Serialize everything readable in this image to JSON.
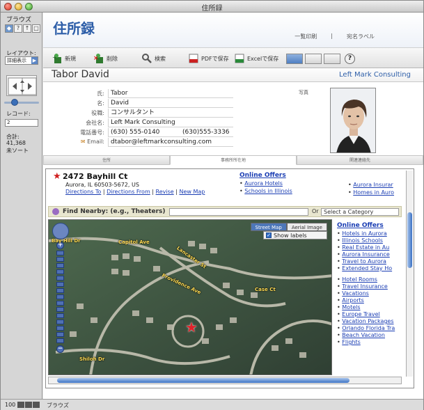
{
  "window": {
    "title": "住所録"
  },
  "sidebar": {
    "mode_label": "ブラウズ",
    "layout_label": "レイアウト:",
    "layout_value": "詳細表示",
    "record_label": "レコード:",
    "record_value": "2",
    "total_label": "合計:",
    "total_value": "41,368",
    "sort_status": "未ソート"
  },
  "bottombar": {
    "zoom": "100",
    "mode": "ブラウズ"
  },
  "app": {
    "title": "住所録",
    "links": [
      "一覧印刷",
      "宛名ラベル"
    ]
  },
  "toolbar": {
    "new_label": "新規",
    "delete_label": "削除",
    "search_label": "検索",
    "pdf_label": "PDFで保存",
    "excel_label": "Excelで保存"
  },
  "record": {
    "full_name": "Tabor David",
    "company_header": "Left Mark Consulting",
    "photo_label": "写真",
    "fields": [
      {
        "label": "氏:",
        "value": "Tabor"
      },
      {
        "label": "名:",
        "value": "David"
      },
      {
        "label": "役職:",
        "value": "コンサルタント"
      },
      {
        "label": "会社名:",
        "value": "Left Mark Consulting"
      },
      {
        "label": "電話番号:",
        "value": "(630) 555-0140",
        "value2": "(630)555-3336"
      },
      {
        "label": "Email:",
        "value": "dtabor@leftmarkconsulting.com"
      }
    ]
  },
  "tabs": [
    "住所",
    "事務所所在地",
    "関連連絡先"
  ],
  "web": {
    "street": "2472 Bayhill Ct",
    "city": "Aurora, IL 60503-5672, US",
    "links": [
      "Directions To",
      "Directions From",
      "Revise",
      "New Map"
    ],
    "online_offers_head": "Online Offers",
    "online_offers": [
      "Aurora Hotels",
      "Schools in Illinois"
    ],
    "right_offers": [
      "Aurora Insurar",
      "Homes in Auro"
    ],
    "find_label": "Find Nearby: (e.g., Theaters)",
    "or_label": "Or",
    "category_placeholder": "Select a Category",
    "map_btn_street": "Street Map",
    "map_btn_aerial": "Aerial Image",
    "show_labels": "Show labels",
    "street_labels": [
      "Capitol Ave",
      "Lancaster St",
      "Providence Ave",
      "Case Ct",
      "Shiloh Dr",
      "Bay Hill Dr"
    ],
    "side_head": "Online Offers",
    "side_offers_1": [
      "Hotels in Aurora",
      "Illinois Schools",
      "Real Estate in Au",
      "Aurora Insurance",
      "Travel to Aurora",
      "Extended Stay Ho"
    ],
    "side_offers_2": [
      "Hotel Rooms",
      "Travel Insurance",
      "Vacations",
      "Airports",
      "Motels",
      "Europe Travel",
      "Vacation Packages",
      "Orlando Florida Tra",
      "Beach Vacation",
      "Flights"
    ]
  }
}
